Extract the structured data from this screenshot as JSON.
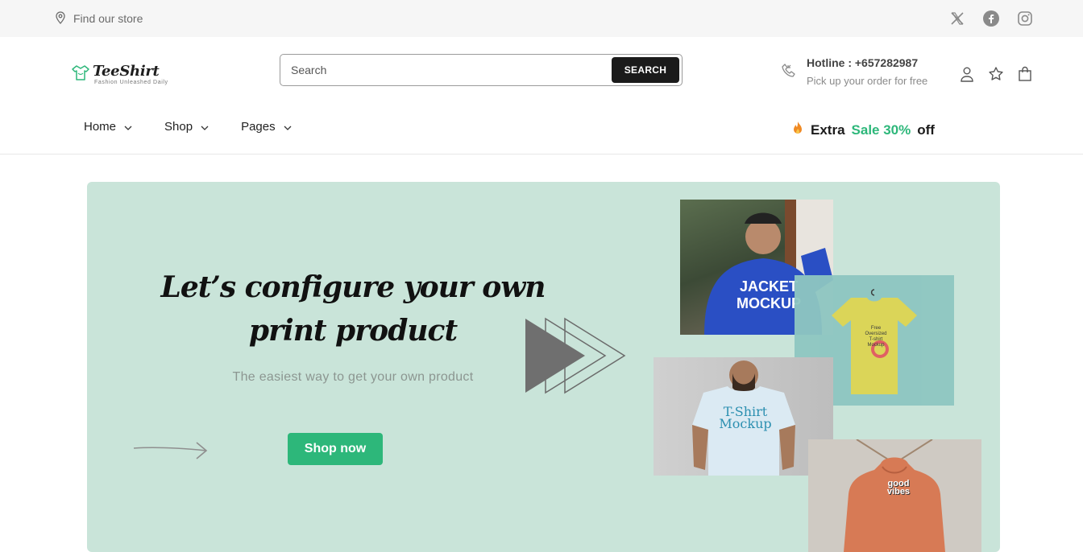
{
  "topbar": {
    "store_label": "Find our store",
    "icons": [
      "map-pin-icon",
      "x-twitter-icon",
      "facebook-icon",
      "instagram-icon"
    ]
  },
  "header": {
    "logo": {
      "name": "TeeShirt",
      "tagline": "Fashion Unleashed Daily"
    },
    "search": {
      "placeholder": "Search",
      "button_label": "SEARCH"
    },
    "hotline": {
      "title": "Hotline : +657282987",
      "subtitle": "Pick up your order for free"
    },
    "icons": [
      "user-icon",
      "star-icon",
      "bag-icon"
    ]
  },
  "nav": {
    "items": [
      {
        "label": "Home"
      },
      {
        "label": "Shop"
      },
      {
        "label": "Pages"
      }
    ],
    "promo": {
      "extra": "Extra",
      "sale": "Sale 30%",
      "off": "off",
      "icon": "fire-icon"
    }
  },
  "hero": {
    "title_line1": "Let’s configure your own",
    "title_line2": "print product",
    "subtitle": "The easiest way to get your own product",
    "cta_label": "Shop now",
    "images": {
      "jacket": {
        "line1": "JACKET",
        "line2": "MOCKUP"
      },
      "yellow_tee": {
        "line1": "Free",
        "line2": "Oversized",
        "line3": "T-shirt",
        "line4": "Mockup"
      },
      "white_tee": {
        "line1": "T-Shirt",
        "line2": "Mockup"
      },
      "hoodie": {
        "line1": "good",
        "line2": "vibes"
      }
    }
  },
  "colors": {
    "accent": "#2db77a",
    "hero_bg": "#c9e4d9",
    "topbar_bg": "#f6f6f6",
    "dark_button": "#1b1b1b"
  }
}
